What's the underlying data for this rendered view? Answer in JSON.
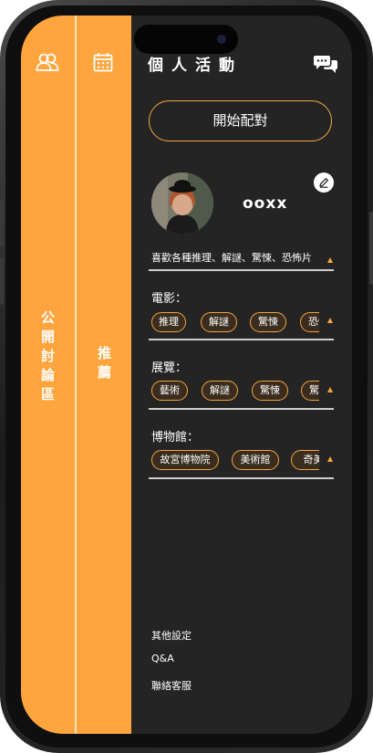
{
  "sidebar": {
    "forum_label": "公開討論區",
    "recommend_label": "推薦"
  },
  "header": {
    "title": "個人活動"
  },
  "main": {
    "match_button": "開始配對",
    "username": "ooxx",
    "bio": "喜歡各種推理、解謎、驚悚、恐怖片",
    "sections": [
      {
        "label": "電影：",
        "tags": [
          "推理",
          "解謎",
          "驚悚",
          "恐怖"
        ]
      },
      {
        "label": "展覽：",
        "tags": [
          "藝術",
          "解謎",
          "驚悚",
          "驚悚"
        ]
      },
      {
        "label": "博物館：",
        "tags": [
          "故宮博物院",
          "美術館",
          "奇美博物館"
        ]
      }
    ],
    "footer_links": [
      "其他設定",
      "Q&A",
      "聯絡客服"
    ]
  },
  "icons": [
    "users-icon",
    "calendar-icon",
    "chat-bubbles-icon",
    "edit-pencil-icon"
  ],
  "colors": {
    "accent": "#ffa53d",
    "background": "#242424"
  }
}
